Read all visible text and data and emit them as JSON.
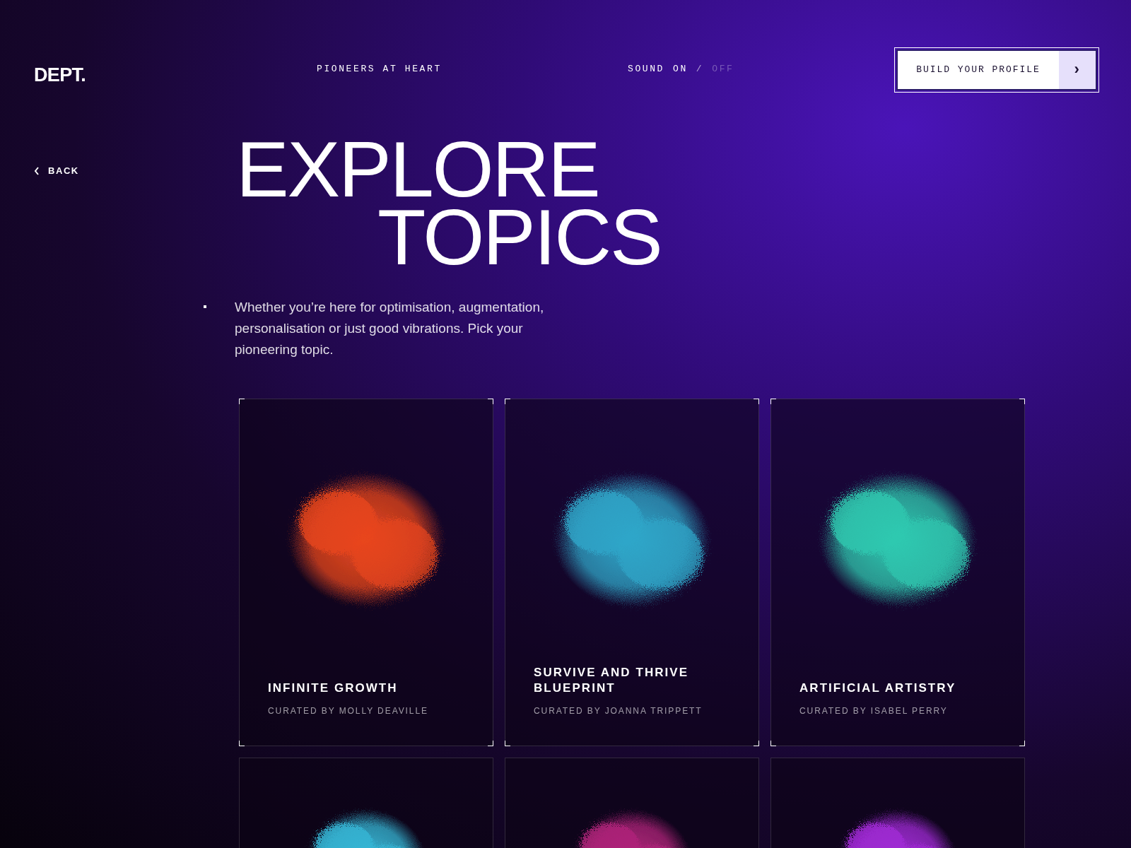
{
  "header": {
    "logo": "DEPT.",
    "tagline": "PIONEERS AT HEART",
    "sound": {
      "prefix": "SOUND",
      "separator": "/",
      "options": [
        {
          "label": "ON",
          "selected": true
        },
        {
          "label": "OFF",
          "selected": false
        }
      ]
    },
    "cta": {
      "label": "BUILD YOUR PROFILE",
      "arrow": "›"
    }
  },
  "back": {
    "label": "BACK"
  },
  "heading": [
    "EXPLORE",
    "TOPICS"
  ],
  "intro": "Whether you’re here for optimisation, augmentation, personalisation or just good vibrations. Pick your pioneering topic.",
  "topics": [
    {
      "title": "INFINITE GROWTH",
      "curator": "CURATED BY MOLLY DEAVILLE",
      "color": "#e8461c"
    },
    {
      "title": "SURVIVE AND THRIVE BLUEPRINT",
      "curator": "CURATED BY JOANNA TRIPPETT",
      "color": "#2fa6c9"
    },
    {
      "title": "ARTIFICIAL ARTISTRY",
      "curator": "CURATED BY ISABEL PERRY",
      "color": "#2fc9b0"
    },
    {
      "color": "#36b7d6"
    },
    {
      "color": "#b0247a"
    },
    {
      "color": "#a12ad6"
    }
  ]
}
